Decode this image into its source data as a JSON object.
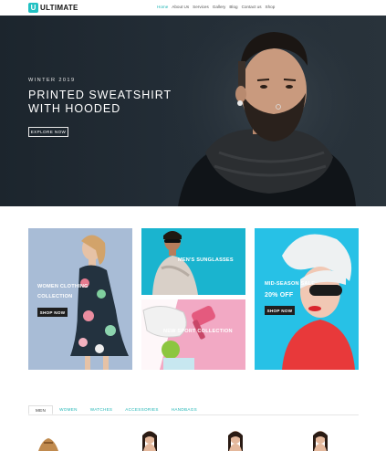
{
  "header": {
    "logo_mark": "U",
    "logo_text": "ULTIMATE",
    "nav": [
      "Home",
      "About Us",
      "Services",
      "Gallery",
      "Blog",
      "Contact us",
      "Shop"
    ]
  },
  "hero": {
    "subtitle": "WINTER 2019",
    "title": "PRINTED SWEATSHIRT WITH HOODED",
    "button": "EXPLORE NOW"
  },
  "collections": {
    "women": {
      "label_line1": "WOMEN CLOTHING",
      "label_line2": "COLLECTION",
      "button": "SHOP NOW"
    },
    "sunglasses": {
      "label": "MEN'S SUNGLASSES"
    },
    "sports": {
      "label": "NEW SPORT COLLECTION"
    },
    "sale": {
      "label_line1": "MID-SEASON SALE",
      "label_line2": "20% OFF",
      "button": "SHOP NOW"
    }
  },
  "tabs": [
    "MEN",
    "WOMEN",
    "WATCHES",
    "ACCESSORIES",
    "HANDBAGS"
  ],
  "colors": {
    "accent": "#1fb5b5",
    "hero_bg": "#1f2831"
  }
}
